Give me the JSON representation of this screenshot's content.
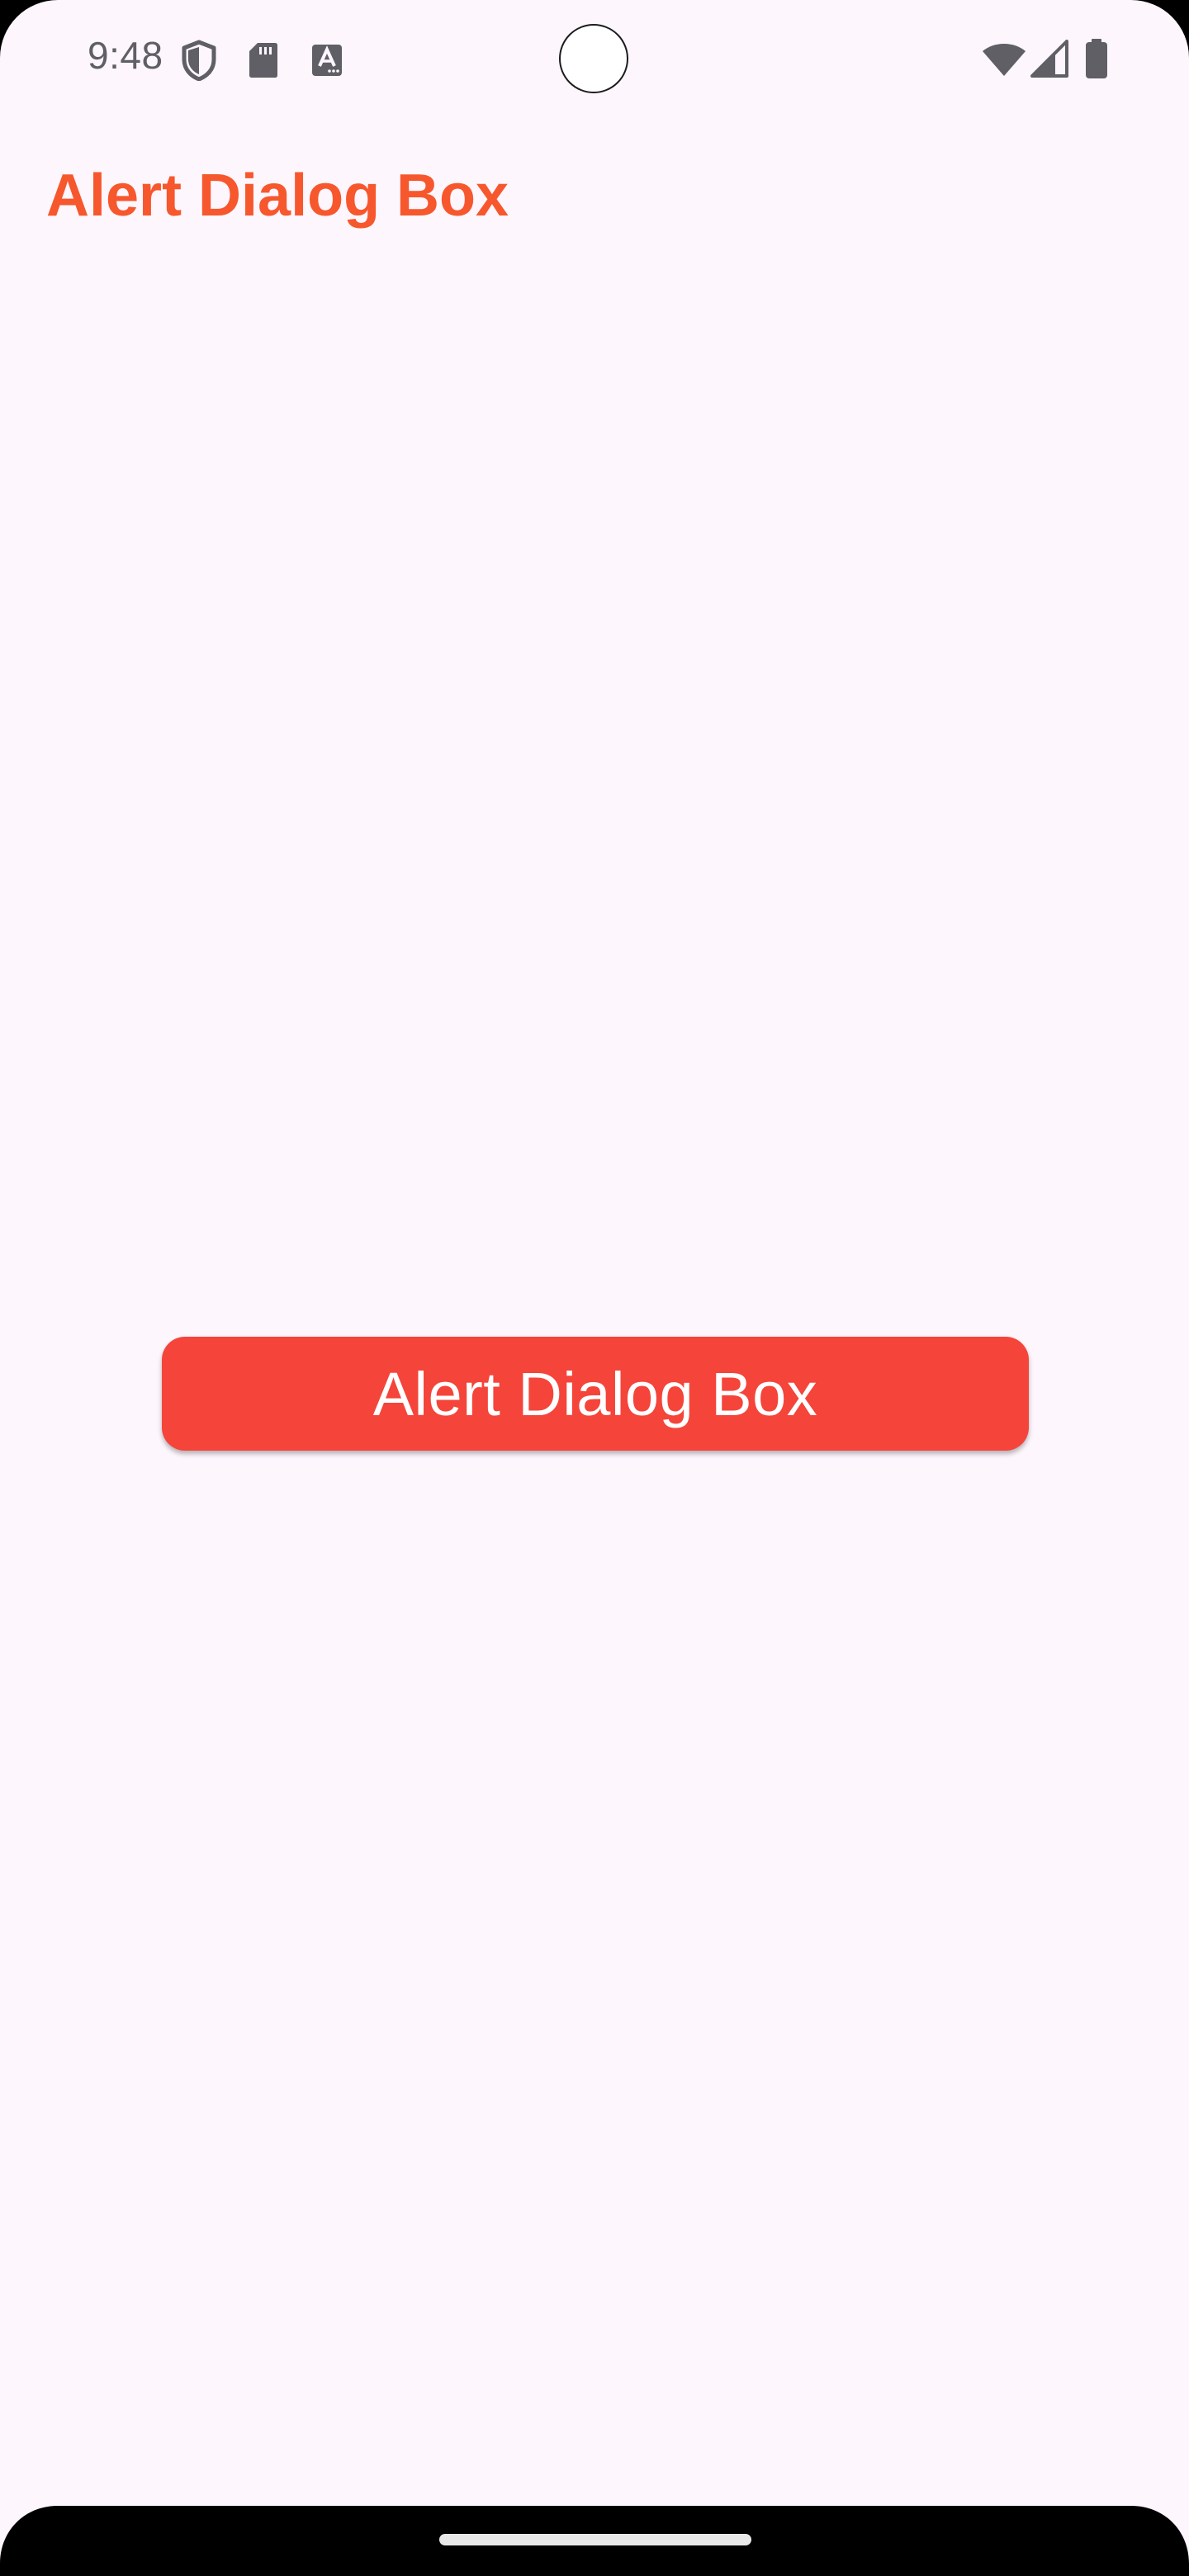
{
  "status_bar": {
    "time": "9:48",
    "icons_left": [
      "shield-icon",
      "sd-card-icon",
      "font-a-icon"
    ],
    "icons_right": [
      "wifi-icon",
      "cell-signal-icon",
      "battery-icon"
    ]
  },
  "app_bar": {
    "title": "Alert Dialog Box"
  },
  "main": {
    "button_label": "Alert Dialog Box"
  },
  "colors": {
    "background": "#fdf6fd",
    "title": "#f7572d",
    "button": "#f5443a",
    "button_text": "#ffffff",
    "status_icons": "#5f5f65"
  }
}
